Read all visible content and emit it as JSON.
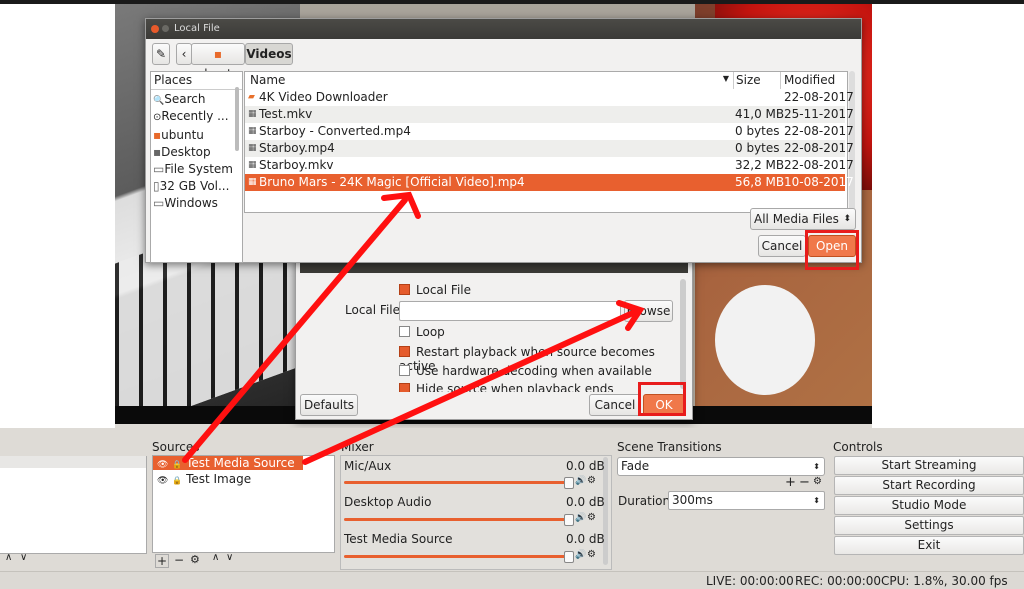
{
  "file_dialog": {
    "title": "Local File",
    "path": [
      "ubuntu",
      "Videos"
    ],
    "places_header": "Places",
    "places": [
      {
        "label": "Search",
        "icon": "search-icon"
      },
      {
        "label": "Recently ...",
        "icon": "clock-icon"
      },
      {
        "label": "ubuntu",
        "icon": "home-folder-icon"
      },
      {
        "label": "Desktop",
        "icon": "desktop-folder-icon"
      },
      {
        "label": "File System",
        "icon": "drive-icon"
      },
      {
        "label": "32 GB Vol...",
        "icon": "usb-drive-icon"
      },
      {
        "label": "Windows",
        "icon": "drive-icon"
      }
    ],
    "columns": {
      "name": "Name",
      "size": "Size",
      "modified": "Modified"
    },
    "files": [
      {
        "name": "4K Video Downloader",
        "size": "",
        "modified": "22-08-2017",
        "icon": "folder-icon"
      },
      {
        "name": "Test.mkv",
        "size": "41,0 MB",
        "modified": "25-11-2017",
        "icon": "video-file-icon"
      },
      {
        "name": "Starboy - Converted.mp4",
        "size": "0 bytes",
        "modified": "22-08-2017",
        "icon": "video-file-icon"
      },
      {
        "name": "Starboy.mp4",
        "size": "0 bytes",
        "modified": "22-08-2017",
        "icon": "video-file-icon"
      },
      {
        "name": "Starboy.mkv",
        "size": "32,2 MB",
        "modified": "22-08-2017",
        "icon": "video-file-icon"
      },
      {
        "name": "Bruno Mars - 24K Magic [Official Video].mp4",
        "size": "56,8 MB",
        "modified": "10-08-2017",
        "icon": "video-file-icon"
      }
    ],
    "filter": "All Media Files",
    "cancel_label": "Cancel",
    "open_label": "Open"
  },
  "properties_dialog": {
    "local_file_checkbox": "Local File",
    "local_file_label": "Local File",
    "local_file_value": "",
    "browse_label": "Browse",
    "options": [
      {
        "label": "Loop",
        "checked": false
      },
      {
        "label": "Restart playback when source becomes active",
        "checked": true
      },
      {
        "label": "Use hardware decoding when available",
        "checked": false
      },
      {
        "label": "Hide source when playback ends",
        "checked": true
      }
    ],
    "defaults_label": "Defaults",
    "cancel_label": "Cancel",
    "ok_label": "OK"
  },
  "sources": {
    "title": "Sources",
    "items": [
      "Test Media Source",
      "Test Image"
    ]
  },
  "mixer": {
    "title": "Mixer",
    "channels": [
      {
        "name": "Mic/Aux",
        "level": "0.0 dB"
      },
      {
        "name": "Desktop Audio",
        "level": "0.0 dB"
      },
      {
        "name": "Test Media Source",
        "level": "0.0 dB"
      }
    ]
  },
  "transitions": {
    "title": "Scene Transitions",
    "selected": "Fade",
    "duration_label": "Duration",
    "duration_value": "300ms"
  },
  "controls": {
    "title": "Controls",
    "buttons": [
      "Start Streaming",
      "Start Recording",
      "Studio Mode",
      "Settings",
      "Exit"
    ]
  },
  "status": {
    "live": "LIVE: 00:00:00",
    "rec": "REC: 00:00:00",
    "cpu": "CPU: 1.8%, 30.00 fps"
  },
  "colors": {
    "accent": "#e8602f",
    "highlight_box": "#e81c1c"
  }
}
